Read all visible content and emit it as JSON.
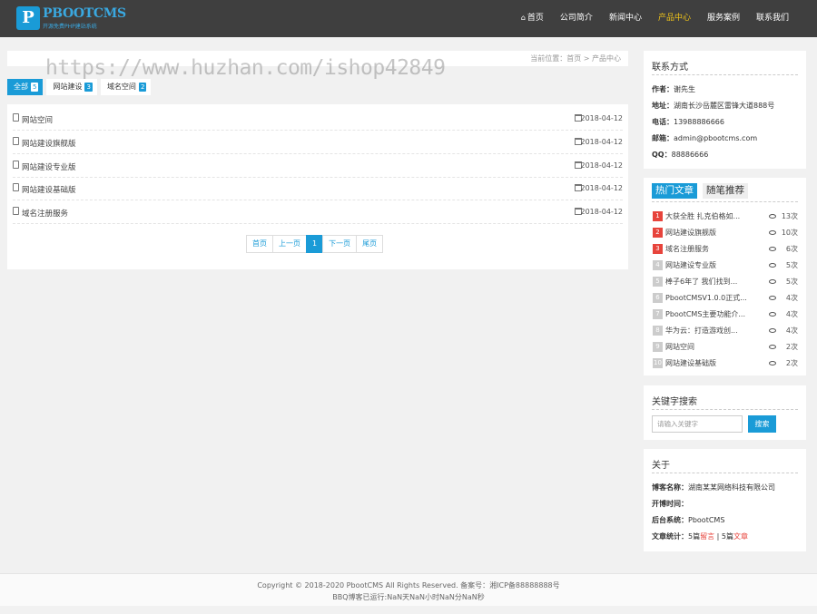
{
  "header": {
    "logo_name": "PBOOTCMS",
    "logo_tagline": "开源免费PHP建站系统",
    "nav": [
      {
        "label": "首页",
        "icon": "home-icon"
      },
      {
        "label": "公司简介"
      },
      {
        "label": "新闻中心"
      },
      {
        "label": "产品中心",
        "active": true
      },
      {
        "label": "服务案例"
      },
      {
        "label": "联系我们"
      }
    ]
  },
  "watermark": "https://www.huzhan.com/ishop42849",
  "breadcrumb": {
    "prefix": "当前位置：",
    "home": "首页",
    "sep": " > ",
    "current": "产品中心"
  },
  "tabs": [
    {
      "label": "全部",
      "count": "5",
      "active": true
    },
    {
      "label": "网站建设",
      "count": "3"
    },
    {
      "label": "域名空间",
      "count": "2"
    }
  ],
  "list": [
    {
      "title": "网站空间",
      "date": "2018-04-12"
    },
    {
      "title": "网站建设旗舰版",
      "date": "2018-04-12"
    },
    {
      "title": "网站建设专业版",
      "date": "2018-04-12"
    },
    {
      "title": "网站建设基础版",
      "date": "2018-04-12"
    },
    {
      "title": "域名注册服务",
      "date": "2018-04-12"
    }
  ],
  "pagination": {
    "first": "首页",
    "prev": "上一页",
    "current": "1",
    "next": "下一页",
    "last": "尾页"
  },
  "contact": {
    "title": "联系方式",
    "author_label": "作者：",
    "author": "谢先生",
    "address_label": "地址：",
    "address": "湖南长沙岳麓区雷锋大道888号",
    "phone_label": "电话：",
    "phone": "13988886666",
    "email_label": "邮箱：",
    "email": "admin@pbootcms.com",
    "qq_label": "QQ：",
    "qq": "88886666"
  },
  "hot": {
    "tab_hot": "热门文章",
    "tab_random": "随笔推荐",
    "items": [
      {
        "rank": "1",
        "title": "大获全胜 扎克伯格如...",
        "views": "13次"
      },
      {
        "rank": "2",
        "title": "网站建设旗舰版",
        "views": "10次"
      },
      {
        "rank": "3",
        "title": "域名注册服务",
        "views": "6次"
      },
      {
        "rank": "4",
        "title": "网站建设专业版",
        "views": "5次"
      },
      {
        "rank": "5",
        "title": "棒子6年了 我们找到...",
        "views": "5次"
      },
      {
        "rank": "6",
        "title": "PbootCMSV1.0.0正式...",
        "views": "4次"
      },
      {
        "rank": "7",
        "title": "PbootCMS主要功能介...",
        "views": "4次"
      },
      {
        "rank": "8",
        "title": "华为云：打造游戏创...",
        "views": "4次"
      },
      {
        "rank": "9",
        "title": "网站空间",
        "views": "2次"
      },
      {
        "rank": "10",
        "title": "网站建设基础版",
        "views": "2次"
      }
    ]
  },
  "search": {
    "title": "关键字搜索",
    "placeholder": "请输入关键字",
    "button": "搜索"
  },
  "about": {
    "title": "关于",
    "name_label": "博客名称：",
    "name": "湖南某某网络科技有限公司",
    "open_label": "开博时间：",
    "open": "",
    "system_label": "后台系统：",
    "system": "PbootCMS",
    "stats_label": "文章统计：",
    "stats_a_num": "5篇",
    "stats_a_word": "留言",
    "stats_sep": " | ",
    "stats_b_num": "5篇",
    "stats_b_word": "文章"
  },
  "footer": {
    "line1": "Copyright © 2018-2020 PbootCMS All Rights Reserved.  备案号：湘ICP备88888888号",
    "line2": "BBQ博客已运行:NaN天NaN小时NaN分NaN秒"
  }
}
